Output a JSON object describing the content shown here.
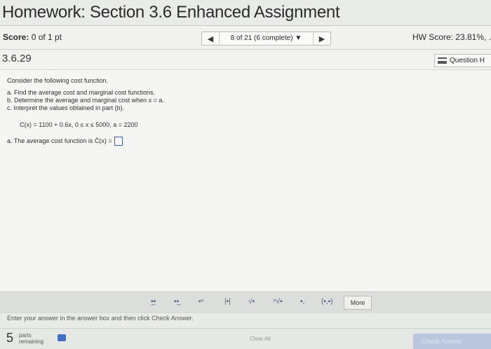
{
  "header": {
    "title": "Homework: Section 3.6 Enhanced Assignment"
  },
  "score_bar": {
    "score_label": "Score:",
    "score_value": "0 of 1 pt",
    "nav_prev_icon": "left-triangle-icon",
    "nav_label": "8 of 21 (6 complete)",
    "nav_dropdown_icon": "caret-down-icon",
    "nav_next_icon": "right-triangle-icon",
    "hw_score": "HW Score: 23.81%, ."
  },
  "question_bar": {
    "number": "3.6.29",
    "button_label": "Question H",
    "button_icon": "list-icon"
  },
  "question": {
    "intro": "Consider the following cost function.",
    "parts": [
      "a. Find the average cost and marginal cost functions.",
      "b. Determine the average and marginal cost when x = a.",
      "c. Interpret the values obtained in part (b)."
    ],
    "function": "C(x) = 1100 + 0.6x, 0 ≤ x ≤ 5000, a = 2200",
    "answer_prompt": "a. The average cost function is C̄(x) ="
  },
  "toolbar": {
    "tools": [
      "fraction-icon",
      "mixed-number-icon",
      "exponent-icon",
      "absolute-value-icon",
      "sqrt-icon",
      "nth-root-icon",
      "subscript-icon",
      "interval-icon"
    ],
    "tool_glyphs": [
      "▪̲▪",
      "▪▪̲",
      "▪ⁿ",
      "|▪|",
      "√▪",
      "ⁿ√▪",
      "▪,",
      "(▪,▪)"
    ],
    "more_label": "More"
  },
  "hint": "Enter your answer in the answer box and then click Check Answer.",
  "footer": {
    "parts_count": "5",
    "parts_label_1": "parts",
    "parts_label_2": "remaining",
    "clear_all": "Clear All",
    "check_answer": "Check Answer",
    "accent": "#3e6fc4"
  }
}
